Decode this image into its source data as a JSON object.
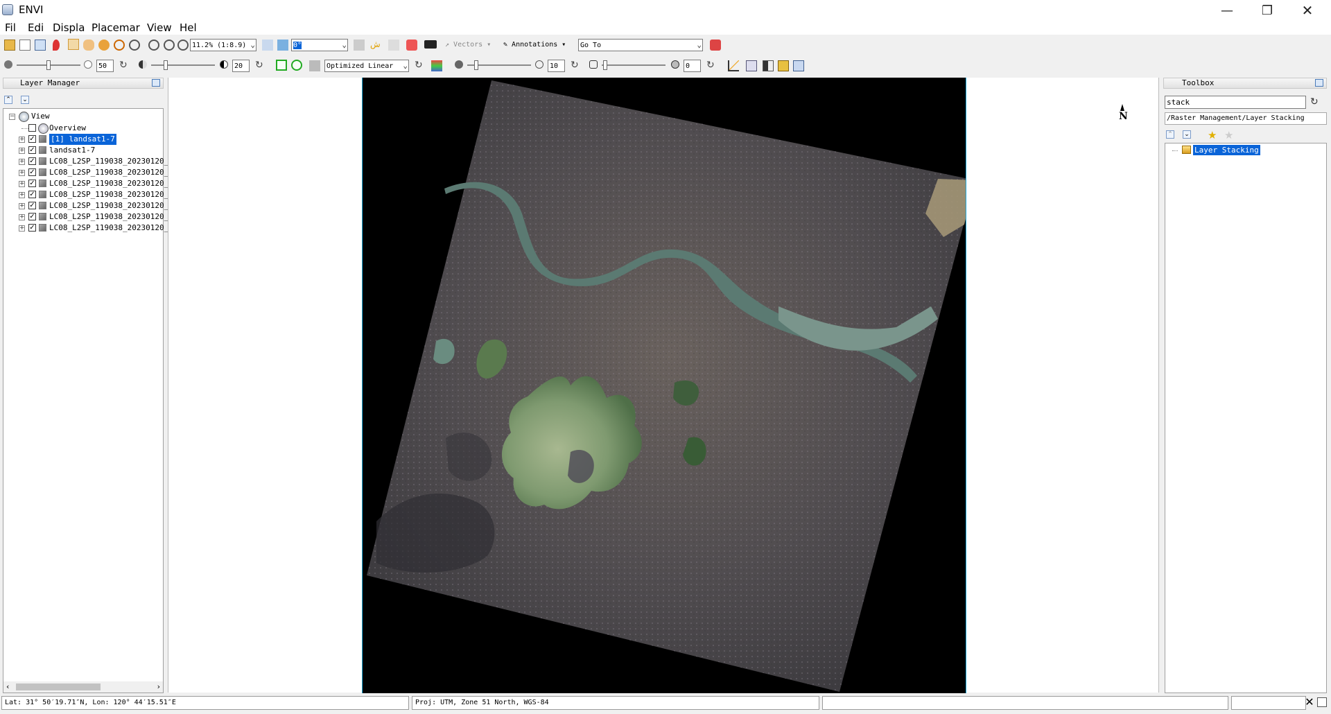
{
  "window": {
    "title": "ENVI"
  },
  "menu": [
    "Fil",
    "Edi",
    "Displa",
    "Placemar",
    "View",
    "Hel"
  ],
  "toolbar": {
    "zoom_value": "11.2% (1:8.9)",
    "rotation_value": "0°",
    "vectors_label": "Vectors",
    "annotations_label": "Annotations",
    "goto_value": "Go To",
    "brightness_value": "50",
    "contrast_value": "20",
    "stretch_value": "Optimized Linear",
    "sharpen_value": "10",
    "transparency_value": "0"
  },
  "layer_manager": {
    "title": "Layer Manager",
    "view_label": "View",
    "items": [
      {
        "label": "Overview",
        "checked": false,
        "selected": false
      },
      {
        "label": "[1] landsat1-7",
        "checked": true,
        "selected": true
      },
      {
        "label": "landsat1-7",
        "checked": true,
        "selected": false
      },
      {
        "label": "LC08_L2SP_119038_20230120_",
        "checked": true,
        "selected": false
      },
      {
        "label": "LC08_L2SP_119038_20230120_",
        "checked": true,
        "selected": false
      },
      {
        "label": "LC08_L2SP_119038_20230120_",
        "checked": true,
        "selected": false
      },
      {
        "label": "LC08_L2SP_119038_20230120_",
        "checked": true,
        "selected": false
      },
      {
        "label": "LC08_L2SP_119038_20230120_",
        "checked": true,
        "selected": false
      },
      {
        "label": "LC08_L2SP_119038_20230120_",
        "checked": true,
        "selected": false
      },
      {
        "label": "LC08_L2SP_119038_20230120_",
        "checked": true,
        "selected": false
      }
    ]
  },
  "toolbox": {
    "title": "Toolbox",
    "search_value": "stack",
    "path": "/Raster Management/Layer Stacking",
    "result": "Layer Stacking"
  },
  "map": {
    "north_label": "N"
  },
  "status": {
    "latlon": "Lat: 31° 50′19.71″N, Lon: 120° 44′15.51″E",
    "proj": "Proj: UTM, Zone 51 North, WGS-84",
    "field3": "",
    "field4": ""
  },
  "colors": {
    "selection": "#0a64d8",
    "image_border": "#22aadd"
  }
}
